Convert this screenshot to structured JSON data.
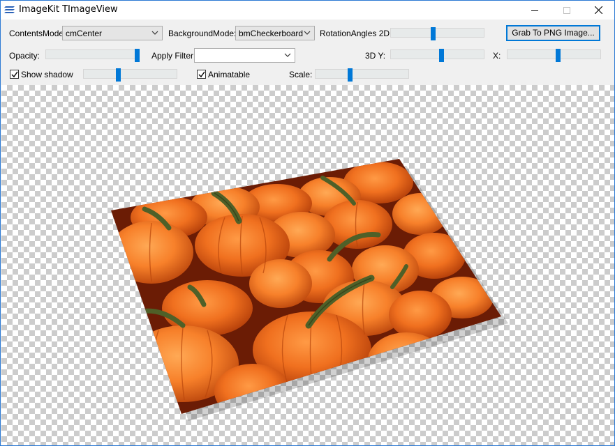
{
  "window": {
    "title": "ImageKit TImageView",
    "border_color": "#2b79d4"
  },
  "toolbar": {
    "contents_mode": {
      "label": "ContentsMode:",
      "value": "cmCenter"
    },
    "background_mode": {
      "label": "BackgroundMode:",
      "value": "bmCheckerboard"
    },
    "rotation_2d": {
      "label": "RotationAngles 2D:",
      "level": 0.45
    },
    "grab_button": "Grab To PNG Image...",
    "opacity": {
      "label": "Opacity:",
      "level": 1.0
    },
    "apply_filter": {
      "label": "Apply Filter:",
      "value": ""
    },
    "rotation_3d_y": {
      "label": "3D Y:",
      "level": 0.55
    },
    "rotation_3d_x": {
      "label": "X:",
      "level": 0.55
    },
    "show_shadow": {
      "label": "Show shadow",
      "checked": true,
      "level": 0.37
    },
    "animatable": {
      "label": "Animatable",
      "checked": true
    },
    "scale": {
      "label": "Scale:",
      "level": 0.37
    }
  },
  "image": {
    "subject": "pumpkins photo",
    "palette": [
      "#e8601a",
      "#f47a26",
      "#c44a0e",
      "#5a6a2e"
    ]
  },
  "colors": {
    "accent": "#0078d7",
    "checker_dark": "#cccccc",
    "checker_light": "#ffffff"
  }
}
